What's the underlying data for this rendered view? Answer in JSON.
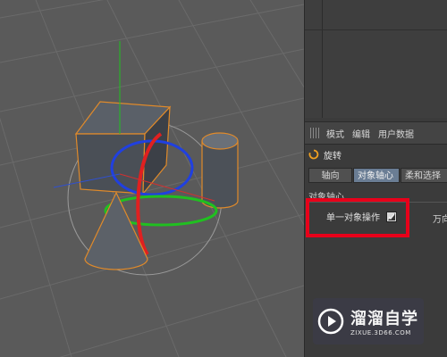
{
  "menu": {
    "items": [
      "模式",
      "编辑",
      "用户数据"
    ]
  },
  "tool": {
    "title": "旋转"
  },
  "tabs": [
    {
      "label": "轴向",
      "active": false
    },
    {
      "label": "对象轴心",
      "active": true
    },
    {
      "label": "柔和选择",
      "active": false
    }
  ],
  "section": {
    "title": "对象轴心"
  },
  "option": {
    "label": "单一对象操作",
    "checked": true
  },
  "extra": {
    "label": "万向"
  },
  "watermark": {
    "brand": "溜溜自学",
    "url": "ZIXUE.3D66.COM"
  },
  "colors": {
    "highlight": "#e8001a",
    "active_tab": "#6a7d94",
    "selection_outline": "#e08a2a",
    "axis_x": "#e02020",
    "axis_y": "#20c020",
    "axis_z": "#2040e0"
  },
  "icons": {
    "tool": "rotate-icon",
    "checkbox": "checkbox-icon",
    "logo": "play-logo-icon",
    "grip": "grip-icon"
  }
}
